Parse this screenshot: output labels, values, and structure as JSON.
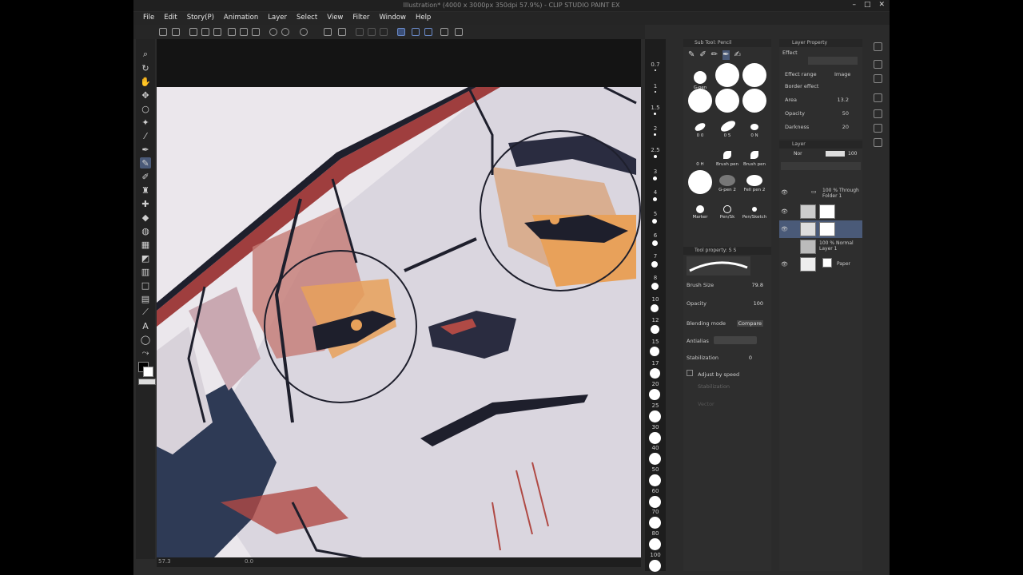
{
  "window": {
    "title": "Illustration* (4000 x 3000px 350dpi 57.9%) - CLIP STUDIO PAINT EX",
    "minimize": "–",
    "maximize": "□",
    "close": "✕"
  },
  "menu": [
    "File",
    "Edit",
    "Story(P)",
    "Animation",
    "Layer",
    "Select",
    "View",
    "Filter",
    "Window",
    "Help"
  ],
  "brush_sizes": [
    "0.7",
    "1",
    "1.5",
    "2",
    "2.5",
    "3",
    "4",
    "5",
    "6",
    "7",
    "8",
    "10",
    "12",
    "15",
    "17",
    "20",
    "25",
    "30",
    "40",
    "50",
    "60",
    "70",
    "80",
    "100"
  ],
  "sub_tool": {
    "title": "Sub Tool: Pencil",
    "brushes": [
      {
        "label": "G-pen"
      },
      {
        "label": "0 0"
      },
      {
        "label": "0 5"
      },
      {
        "label": "0 N"
      },
      {
        "label": "0 H"
      },
      {
        "label": "Brush pen"
      },
      {
        "label": "Brush pen"
      },
      {
        "label": "G-pen 2"
      },
      {
        "label": "Fell pen 2"
      },
      {
        "label": "Marker"
      },
      {
        "label": "Pen/Sk"
      },
      {
        "label": "Pen/Sketch"
      }
    ]
  },
  "tool_property": {
    "title": "Tool property: S S",
    "brush_size_label": "Brush Size",
    "brush_size_value": "79.8",
    "opacity_label": "Opacity",
    "opacity_value": "100",
    "blending_label": "Blending mode",
    "blending_value": "Compare",
    "antialias_label": "Antialias",
    "stabilization_label": "Stabilization",
    "stabilization_value": "0",
    "adjust_speed_label": "Adjust by speed",
    "stabilization_sub": "Stabilization",
    "vector_label": "Vector"
  },
  "layer_property": {
    "title": "Layer Property",
    "effect_label": "Effect",
    "effect_range_label": "Effect range",
    "effect_range_value": "Image",
    "border_effect_label": "Border effect",
    "area_label": "Area",
    "area_value": "13.2",
    "opacity_label": "Opacity",
    "opacity_value": "50",
    "darkness_label": "Darkness",
    "darkness_value": "20"
  },
  "layers": {
    "title": "Layer",
    "blend": "Nor",
    "opacity": "100",
    "items": [
      {
        "name": "100 % Through\nFolder 1"
      },
      {
        "name": ""
      },
      {
        "name": ""
      },
      {
        "name": "100 % Normal\nLayer 1"
      },
      {
        "name": "Paper"
      }
    ]
  },
  "status": {
    "zoom": "57.3",
    "angle": "0.0"
  },
  "colors": {
    "app_bg": "#2b2b2b",
    "canvas_bg": "#e8e4e8",
    "accent": "#4a5a78",
    "line": "#1e1f2c",
    "orange": "#e8a15a",
    "red": "#b04a45"
  }
}
